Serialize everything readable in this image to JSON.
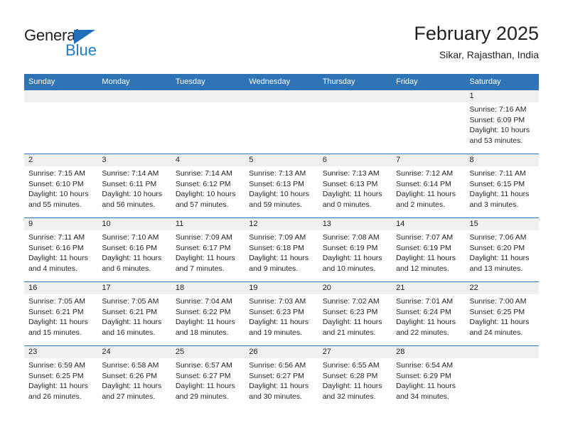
{
  "brand": {
    "name_part1": "General",
    "name_part2": "Blue",
    "triangle_icon": "triangle-icon",
    "colors": {
      "blue": "#1f7cc4",
      "dark": "#231f20",
      "header_blue": "#2f74b5"
    }
  },
  "header": {
    "title": "February 2025",
    "subtitle": "Sikar, Rajasthan, India"
  },
  "weekdays": [
    "Sunday",
    "Monday",
    "Tuesday",
    "Wednesday",
    "Thursday",
    "Friday",
    "Saturday"
  ],
  "weeks": [
    [
      {
        "empty": true
      },
      {
        "empty": true
      },
      {
        "empty": true
      },
      {
        "empty": true
      },
      {
        "empty": true
      },
      {
        "empty": true
      },
      {
        "day": "1",
        "sunrise": "Sunrise: 7:16 AM",
        "sunset": "Sunset: 6:09 PM",
        "daylight": "Daylight: 10 hours and 53 minutes."
      }
    ],
    [
      {
        "day": "2",
        "sunrise": "Sunrise: 7:15 AM",
        "sunset": "Sunset: 6:10 PM",
        "daylight": "Daylight: 10 hours and 55 minutes."
      },
      {
        "day": "3",
        "sunrise": "Sunrise: 7:14 AM",
        "sunset": "Sunset: 6:11 PM",
        "daylight": "Daylight: 10 hours and 56 minutes."
      },
      {
        "day": "4",
        "sunrise": "Sunrise: 7:14 AM",
        "sunset": "Sunset: 6:12 PM",
        "daylight": "Daylight: 10 hours and 57 minutes."
      },
      {
        "day": "5",
        "sunrise": "Sunrise: 7:13 AM",
        "sunset": "Sunset: 6:13 PM",
        "daylight": "Daylight: 10 hours and 59 minutes."
      },
      {
        "day": "6",
        "sunrise": "Sunrise: 7:13 AM",
        "sunset": "Sunset: 6:13 PM",
        "daylight": "Daylight: 11 hours and 0 minutes."
      },
      {
        "day": "7",
        "sunrise": "Sunrise: 7:12 AM",
        "sunset": "Sunset: 6:14 PM",
        "daylight": "Daylight: 11 hours and 2 minutes."
      },
      {
        "day": "8",
        "sunrise": "Sunrise: 7:11 AM",
        "sunset": "Sunset: 6:15 PM",
        "daylight": "Daylight: 11 hours and 3 minutes."
      }
    ],
    [
      {
        "day": "9",
        "sunrise": "Sunrise: 7:11 AM",
        "sunset": "Sunset: 6:16 PM",
        "daylight": "Daylight: 11 hours and 4 minutes."
      },
      {
        "day": "10",
        "sunrise": "Sunrise: 7:10 AM",
        "sunset": "Sunset: 6:16 PM",
        "daylight": "Daylight: 11 hours and 6 minutes."
      },
      {
        "day": "11",
        "sunrise": "Sunrise: 7:09 AM",
        "sunset": "Sunset: 6:17 PM",
        "daylight": "Daylight: 11 hours and 7 minutes."
      },
      {
        "day": "12",
        "sunrise": "Sunrise: 7:09 AM",
        "sunset": "Sunset: 6:18 PM",
        "daylight": "Daylight: 11 hours and 9 minutes."
      },
      {
        "day": "13",
        "sunrise": "Sunrise: 7:08 AM",
        "sunset": "Sunset: 6:19 PM",
        "daylight": "Daylight: 11 hours and 10 minutes."
      },
      {
        "day": "14",
        "sunrise": "Sunrise: 7:07 AM",
        "sunset": "Sunset: 6:19 PM",
        "daylight": "Daylight: 11 hours and 12 minutes."
      },
      {
        "day": "15",
        "sunrise": "Sunrise: 7:06 AM",
        "sunset": "Sunset: 6:20 PM",
        "daylight": "Daylight: 11 hours and 13 minutes."
      }
    ],
    [
      {
        "day": "16",
        "sunrise": "Sunrise: 7:05 AM",
        "sunset": "Sunset: 6:21 PM",
        "daylight": "Daylight: 11 hours and 15 minutes."
      },
      {
        "day": "17",
        "sunrise": "Sunrise: 7:05 AM",
        "sunset": "Sunset: 6:21 PM",
        "daylight": "Daylight: 11 hours and 16 minutes."
      },
      {
        "day": "18",
        "sunrise": "Sunrise: 7:04 AM",
        "sunset": "Sunset: 6:22 PM",
        "daylight": "Daylight: 11 hours and 18 minutes."
      },
      {
        "day": "19",
        "sunrise": "Sunrise: 7:03 AM",
        "sunset": "Sunset: 6:23 PM",
        "daylight": "Daylight: 11 hours and 19 minutes."
      },
      {
        "day": "20",
        "sunrise": "Sunrise: 7:02 AM",
        "sunset": "Sunset: 6:23 PM",
        "daylight": "Daylight: 11 hours and 21 minutes."
      },
      {
        "day": "21",
        "sunrise": "Sunrise: 7:01 AM",
        "sunset": "Sunset: 6:24 PM",
        "daylight": "Daylight: 11 hours and 22 minutes."
      },
      {
        "day": "22",
        "sunrise": "Sunrise: 7:00 AM",
        "sunset": "Sunset: 6:25 PM",
        "daylight": "Daylight: 11 hours and 24 minutes."
      }
    ],
    [
      {
        "day": "23",
        "sunrise": "Sunrise: 6:59 AM",
        "sunset": "Sunset: 6:25 PM",
        "daylight": "Daylight: 11 hours and 26 minutes."
      },
      {
        "day": "24",
        "sunrise": "Sunrise: 6:58 AM",
        "sunset": "Sunset: 6:26 PM",
        "daylight": "Daylight: 11 hours and 27 minutes."
      },
      {
        "day": "25",
        "sunrise": "Sunrise: 6:57 AM",
        "sunset": "Sunset: 6:27 PM",
        "daylight": "Daylight: 11 hours and 29 minutes."
      },
      {
        "day": "26",
        "sunrise": "Sunrise: 6:56 AM",
        "sunset": "Sunset: 6:27 PM",
        "daylight": "Daylight: 11 hours and 30 minutes."
      },
      {
        "day": "27",
        "sunrise": "Sunrise: 6:55 AM",
        "sunset": "Sunset: 6:28 PM",
        "daylight": "Daylight: 11 hours and 32 minutes."
      },
      {
        "day": "28",
        "sunrise": "Sunrise: 6:54 AM",
        "sunset": "Sunset: 6:29 PM",
        "daylight": "Daylight: 11 hours and 34 minutes."
      },
      {
        "empty": true
      }
    ]
  ]
}
